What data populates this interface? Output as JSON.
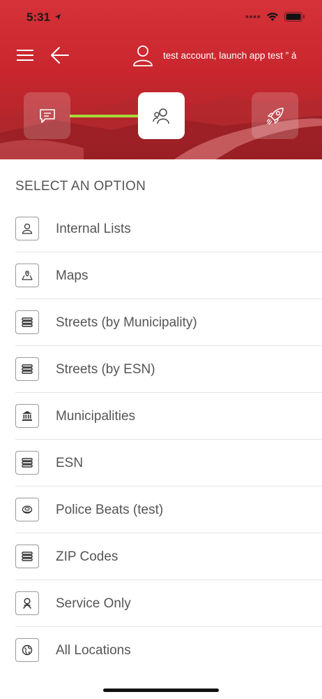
{
  "status_bar": {
    "time": "5:31",
    "icons": [
      "location-arrow-icon",
      "signal-dots-icon",
      "wifi-icon",
      "battery-icon"
    ]
  },
  "nav": {
    "menu_icon": "hamburger-icon",
    "back_icon": "back-arrow-icon",
    "user_icon": "user-icon",
    "account_label": "test account, launch app test ” á"
  },
  "stepper": {
    "steps": [
      {
        "icon": "chat-icon",
        "state": "inactive"
      },
      {
        "icon": "users-icon",
        "state": "active"
      },
      {
        "icon": "rocket-icon",
        "state": "inactive"
      }
    ],
    "progress_color": "#a9d83b"
  },
  "content": {
    "section_title": "SELECT AN OPTION",
    "options": [
      {
        "label": "Internal Lists",
        "icon": "person-icon"
      },
      {
        "label": "Maps",
        "icon": "map-pin-icon"
      },
      {
        "label": "Streets (by Municipality)",
        "icon": "stack-icon"
      },
      {
        "label": "Streets (by ESN)",
        "icon": "stack-icon"
      },
      {
        "label": "Municipalities",
        "icon": "building-icon"
      },
      {
        "label": "ESN",
        "icon": "stack-icon"
      },
      {
        "label": "Police Beats (test)",
        "icon": "badge-icon"
      },
      {
        "label": "ZIP Codes",
        "icon": "stack-icon"
      },
      {
        "label": "Service Only",
        "icon": "service-icon"
      },
      {
        "label": "All Locations",
        "icon": "globe-icon"
      }
    ]
  },
  "colors": {
    "header_red": "#c9262e",
    "text_gray": "#555555",
    "accent_green": "#a9d83b"
  }
}
